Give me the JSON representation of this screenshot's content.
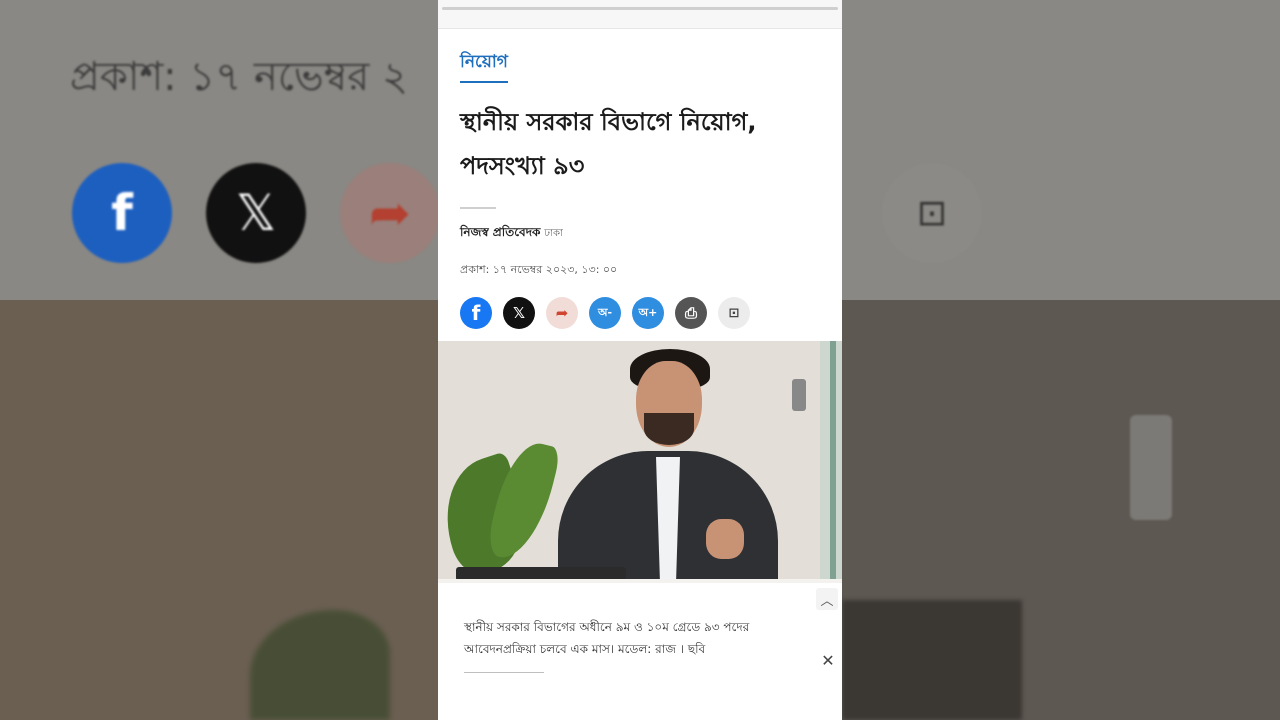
{
  "background": {
    "published_text": "প্রকাশ: ১৭ নভেম্বর ২"
  },
  "article": {
    "category": "নিয়োগ",
    "headline_line1": "স্থানীয় সরকার বিভাগে নিয়োগ,",
    "headline_line2": "পদসংখ্যা ৯৩",
    "author": "নিজস্ব প্রতিবেদক",
    "location": "ঢাকা",
    "published": "প্রকাশ: ১৭ নভেম্বর ২০২৩, ১৩: ০০",
    "image_caption": "স্থানীয় সরকার বিভাগের অধীনে ৯ম ও ১০ম গ্রেডে ৯৩ পদের আবেদনপ্রক্রিয়া চলবে এক মাস। মডেল: রাজ । ছবি"
  },
  "share": {
    "facebook": "f",
    "x": "𝕏",
    "share": "➦",
    "font_decrease": "অ-",
    "font_increase": "অ+",
    "print": "⎙",
    "save": "⊡"
  },
  "controls": {
    "collapse": "︿",
    "close": "✕"
  },
  "colors": {
    "accent": "#1f6fbf",
    "facebook": "#1877f2"
  }
}
